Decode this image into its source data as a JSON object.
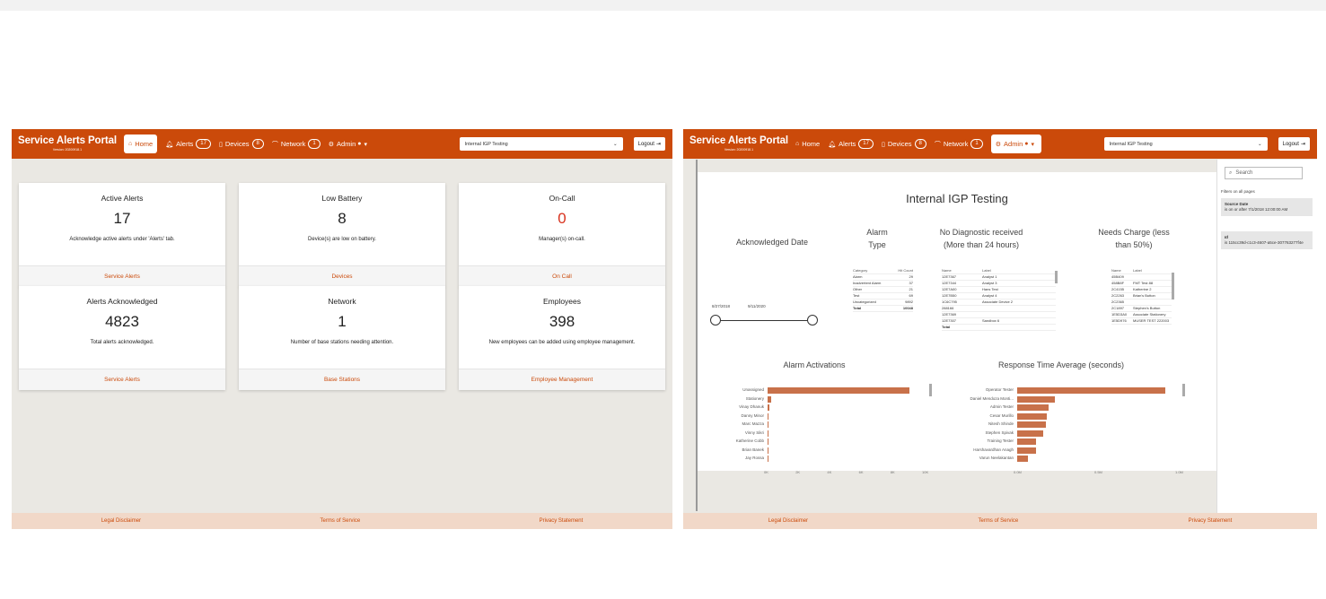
{
  "colors": {
    "accent": "#cb4a0a",
    "background": "#eae8e3",
    "bar": "#c8714a",
    "alert_red": "#d8321e",
    "footer": "#f1d8c8"
  },
  "nav": {
    "brand": "Service Alerts Portal",
    "version": "Version: 20200918.1",
    "home": "Home",
    "alerts": "Alerts",
    "alerts_count": "17",
    "devices": "Devices",
    "devices_count": "8",
    "network": "Network",
    "network_count": "1",
    "admin": "Admin",
    "account_select": "Internal IGP Testing",
    "logout": "Logout"
  },
  "footer": {
    "legal": "Legal Disclaimer",
    "terms": "Terms of Service",
    "privacy": "Privacy Statement"
  },
  "home": {
    "cards": [
      {
        "title": "Active Alerts",
        "value": "17",
        "desc": "Acknowledge active alerts under 'Alerts' tab.",
        "link": "Service Alerts"
      },
      {
        "title": "Low Battery",
        "value": "8",
        "desc": "Device(s) are low on battery.",
        "link": "Devices"
      },
      {
        "title": "On-Call",
        "value": "0",
        "desc": "Manager(s) on-call.",
        "link": "On Call"
      },
      {
        "title": "Alerts Acknowledged",
        "value": "4823",
        "desc": "Total alerts acknowledged.",
        "link": "Service Alerts"
      },
      {
        "title": "Network",
        "value": "1",
        "desc": "Number of base stations needing attention.",
        "link": "Base Stations"
      },
      {
        "title": "Employees",
        "value": "398",
        "desc": "New employees can be added using employee management.",
        "link": "Employee Management"
      }
    ]
  },
  "report": {
    "title": "Internal IGP Testing",
    "ack_date": {
      "label": "Acknowledged Date",
      "start": "8/27/2018",
      "end": "9/11/2020"
    },
    "alarm_type": {
      "title": "Alarm Type",
      "headers": [
        "Category",
        "Hit Count"
      ],
      "rows": [
        [
          "Alarm",
          "29"
        ],
        [
          "Inadvertent Alarm",
          "37"
        ],
        [
          "Other",
          "21"
        ],
        [
          "Test",
          "69"
        ],
        [
          "Uncategorized",
          "9892"
        ]
      ],
      "total_label": "Total",
      "total_value": "10048"
    },
    "no_diag": {
      "title": "No Diagnostic received (More than 24 hours)",
      "headers": [
        "Name",
        "Label"
      ],
      "rows": [
        [
          "12E7367",
          "Analyst 1"
        ],
        [
          "12E7344",
          "Analyst 3"
        ],
        [
          "12E7A00",
          "Hans Test"
        ],
        [
          "12E7B50",
          "Analyst 4"
        ],
        [
          "1C6C795",
          "Associate Device 2"
        ],
        [
          "288166",
          ""
        ],
        [
          "12E7369",
          ""
        ],
        [
          "12E7307",
          "Sandbox 6"
        ]
      ],
      "total_label": "Total"
    },
    "needs_charge": {
      "title": "Needs Charge (less than 50%)",
      "headers": [
        "Name",
        "Label"
      ],
      "rows": [
        [
          "45B409",
          ""
        ],
        [
          "458B8F",
          "FMT Test 88"
        ],
        [
          "2C4155",
          "Katherine 2"
        ],
        [
          "2C2263",
          "Brian's Button"
        ],
        [
          "2C2365",
          ""
        ],
        [
          "2C1897",
          "Stephen's Button"
        ],
        [
          "1E5D3A0",
          "Associate Stationery"
        ],
        [
          "1E5D976",
          "MUSER TEST 222003"
        ]
      ]
    },
    "activations": {
      "title": "Alarm Activations",
      "ticks": [
        "0K",
        "2K",
        "4K",
        "6K",
        "8K",
        "10K"
      ]
    },
    "response": {
      "title": "Response Time Average (seconds)",
      "ticks": [
        "0.0M",
        "0.5M",
        "1.0M"
      ]
    },
    "filters": {
      "search": "Search",
      "heading": "Filters on all pages",
      "f1_title": "Source Date",
      "f1_desc": "is on or after 7/1/2018 12:00:00 AM",
      "f2_title": "Id",
      "f2_desc": "is 115cc39d-c1c3-4607-a5ce-307763277f4e"
    }
  },
  "chart_data": [
    {
      "type": "bar",
      "title": "Alarm Activations",
      "categories": [
        "Unassigned",
        "Stationery",
        "Vinay Dhanuk",
        "Danny Minor",
        "Marc Mazza",
        "Vinny Sikri",
        "Katherine Cobb",
        "Brian Banek",
        "Jay Rossa"
      ],
      "values": [
        9000,
        200,
        100,
        80,
        70,
        60,
        50,
        40,
        30
      ],
      "xlim": [
        0,
        10000
      ]
    },
    {
      "type": "bar",
      "title": "Response Time Average (seconds)",
      "categories": [
        "Operator Tester",
        "Daniel Mendoza Monti...",
        "Admin Tester",
        "Cesar Murillo",
        "Nitesh Shinde",
        "Stephen Spivak",
        "Training Tester",
        "Harshavardhan Anagh",
        "Varun Neelakantan"
      ],
      "values": [
        1100000,
        280000,
        230000,
        220000,
        210000,
        190000,
        140000,
        140000,
        80000
      ],
      "xlim": [
        0,
        1200000
      ]
    }
  ]
}
